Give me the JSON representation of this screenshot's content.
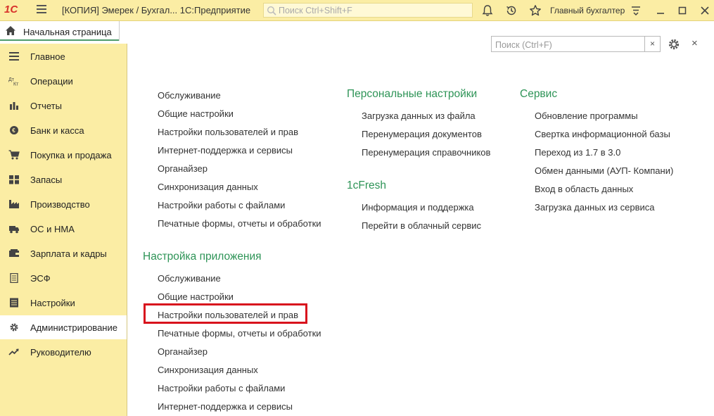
{
  "titlebar": {
    "logo": "1С",
    "title": "[КОПИЯ] Эмерек / Бухгал...   1С:Предприятие",
    "search_placeholder": "Поиск Ctrl+Shift+F",
    "user": "Главный бухгалтер"
  },
  "home_tab": {
    "label": "Начальная страница"
  },
  "sidebar": {
    "items": [
      {
        "label": "Главное",
        "icon": "menu-icon"
      },
      {
        "label": "Операции",
        "icon": "operations-icon"
      },
      {
        "label": "Отчеты",
        "icon": "bar-chart-icon"
      },
      {
        "label": "Банк и касса",
        "icon": "coin-icon"
      },
      {
        "label": "Покупка и продажа",
        "icon": "cart-icon"
      },
      {
        "label": "Запасы",
        "icon": "grid-icon"
      },
      {
        "label": "Производство",
        "icon": "factory-icon"
      },
      {
        "label": "ОС и НМА",
        "icon": "truck-icon"
      },
      {
        "label": "Зарплата и кадры",
        "icon": "wallet-icon"
      },
      {
        "label": "ЭСФ",
        "icon": "document-icon"
      },
      {
        "label": "Настройки",
        "icon": "settings-list-icon"
      },
      {
        "label": "Администрирование",
        "icon": "gear-icon"
      },
      {
        "label": "Руководителю",
        "icon": "trend-icon"
      }
    ],
    "active_label": "Администрирование"
  },
  "main": {
    "search_placeholder": "Поиск (Ctrl+F)",
    "clear_label": "×",
    "close_label": "×",
    "col1_top_links": [
      "Обслуживание",
      "Общие настройки",
      "Настройки пользователей и прав",
      "Интернет-поддержка и сервисы",
      "Органайзер",
      "Синхронизация данных",
      "Настройки работы с файлами",
      "Печатные формы, отчеты и обработки"
    ],
    "app_settings": {
      "title": "Настройка приложения",
      "links": [
        "Обслуживание",
        "Общие настройки",
        "Настройки пользователей и прав",
        "Печатные формы, отчеты и обработки",
        "Органайзер",
        "Синхронизация данных",
        "Настройки работы с файлами",
        "Интернет-поддержка и сервисы"
      ]
    },
    "personal": {
      "title": "Персональные настройки",
      "links": [
        "Загрузка данных из файла",
        "Перенумерация документов",
        "Перенумерация справочников"
      ]
    },
    "fresh": {
      "title": "1cFresh",
      "links": [
        "Информация и поддержка",
        "Перейти в облачный сервис"
      ]
    },
    "service": {
      "title": "Сервис",
      "links": [
        "Обновление программы",
        "Свертка информационной базы",
        "Переход из 1.7 в 3.0",
        "Обмен данными (АУП- Компани)",
        "Вход в область данных",
        "Загрузка данных из сервиса"
      ]
    }
  },
  "colors": {
    "sidebar_bg": "#fbeda4",
    "section_green": "#2e9457",
    "highlight_red": "#d8131d"
  }
}
